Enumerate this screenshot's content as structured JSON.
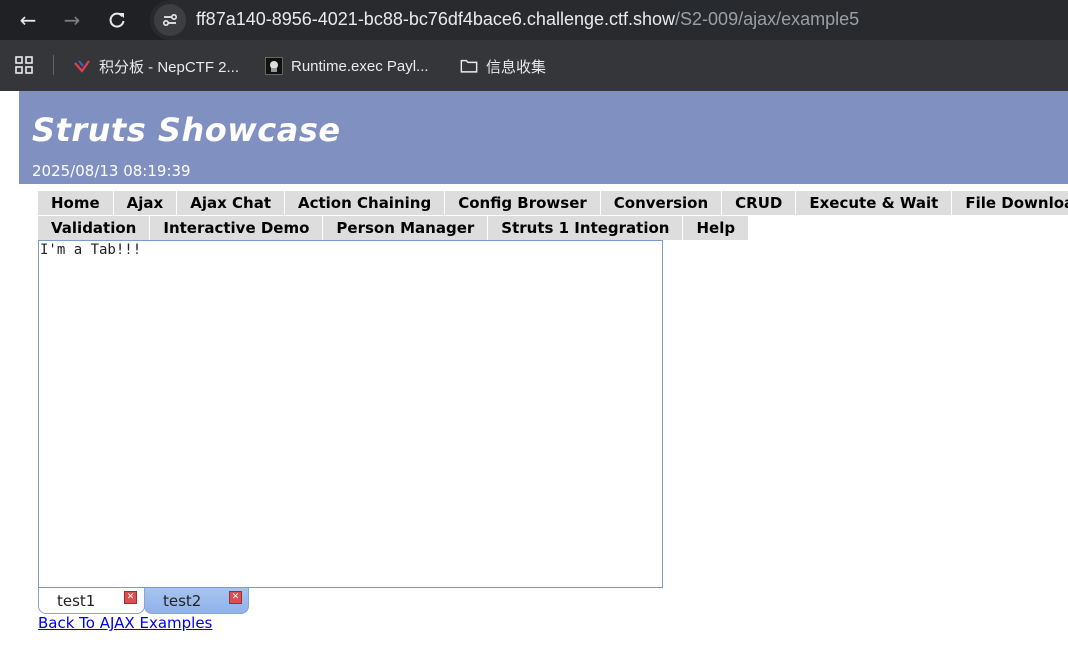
{
  "browser": {
    "url_host": "ff87a140-8956-4021-bc88-bc76df4bace6.challenge.ctf.show",
    "url_path": "/S2-009/ajax/example5",
    "bookmarks": [
      {
        "label": "积分板 - NepCTF 2..."
      },
      {
        "label": "Runtime.exec Payl..."
      },
      {
        "label": "信息收集"
      }
    ]
  },
  "page": {
    "title": "Struts Showcase",
    "datetime": "2025/08/13 08:19:39",
    "menu_row1": [
      "Home",
      "Ajax",
      "Ajax Chat",
      "Action Chaining",
      "Config Browser",
      "Conversion",
      "CRUD",
      "Execute & Wait",
      "File Download"
    ],
    "menu_row2": [
      "Validation",
      "Interactive Demo",
      "Person Manager",
      "Struts 1 Integration",
      "Help"
    ],
    "tab_content": "I'm a Tab!!!",
    "tabs": [
      {
        "label": "test1",
        "active": true
      },
      {
        "label": "test2",
        "active": false
      }
    ],
    "back_link": "Back To AJAX Examples"
  },
  "colors": {
    "banner": "#8090c0",
    "menu_bg": "#dddddd",
    "panel_border": "#7a9cc8",
    "link": "#0000ee"
  }
}
